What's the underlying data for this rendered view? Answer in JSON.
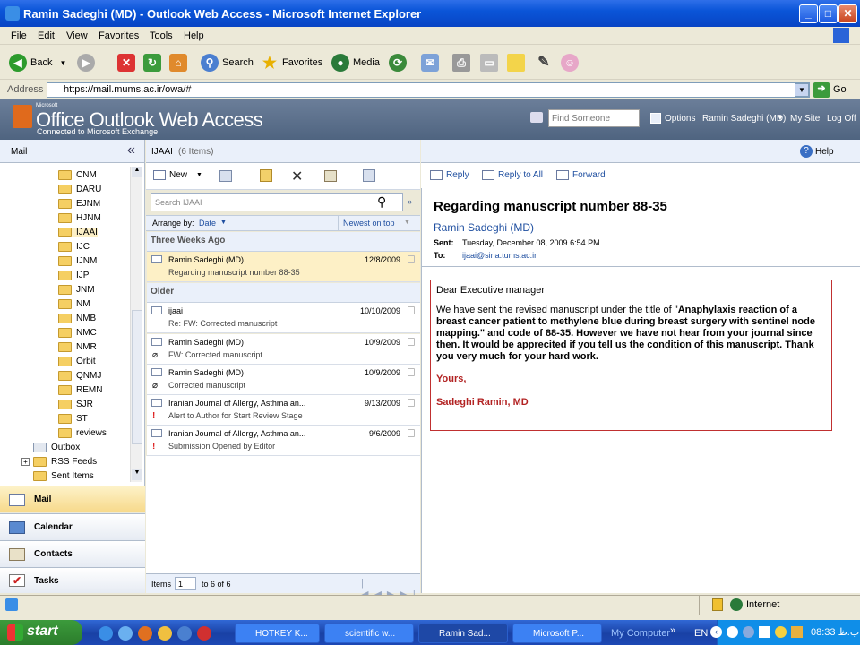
{
  "window": {
    "title": "Ramin Sadeghi (MD) - Outlook Web Access - Microsoft Internet Explorer"
  },
  "menu": [
    "File",
    "Edit",
    "View",
    "Favorites",
    "Tools",
    "Help"
  ],
  "toolbar": {
    "back": "Back",
    "search": "Search",
    "favorites": "Favorites",
    "media": "Media"
  },
  "address": {
    "label": "Address",
    "url": "https://mail.mums.ac.ir/owa/#",
    "go": "Go"
  },
  "owa": {
    "ms": "Microsoft",
    "brand": "Office Outlook Web Access",
    "subtitle": "Connected to Microsoft Exchange",
    "find_placeholder": "Find Someone",
    "options": "Options",
    "user": "Ramin Sadeghi (MD)",
    "my_site": "My Site",
    "log_off": "Log Off",
    "help": "Help"
  },
  "nav": {
    "header": "Mail",
    "folders": [
      "CNM",
      "DARU",
      "EJNM",
      "HJNM",
      "IJAAI",
      "IJC",
      "IJNM",
      "IJP",
      "JNM",
      "NM",
      "NMB",
      "NMC",
      "NMR",
      "Orbit",
      "QNMJ",
      "REMN",
      "SJR",
      "ST",
      "reviews"
    ],
    "outbox": "Outbox",
    "rss": "RSS Feeds",
    "sent": "Sent Items",
    "buttons": [
      "Mail",
      "Calendar",
      "Contacts",
      "Tasks"
    ]
  },
  "list": {
    "folder": "IJAAI",
    "count": "(6 Items)",
    "new_label": "New",
    "search_placeholder": "Search IJAAI",
    "arrange_by": "Arrange by:",
    "arrange_field": "Date",
    "sort": "Newest on top",
    "groups": [
      "Three Weeks Ago",
      "Older"
    ],
    "messages": [
      {
        "from": "Ramin Sadeghi (MD)",
        "subject": "Regarding manuscript number 88-35",
        "date": "12/8/2009"
      },
      {
        "from": "ijaai",
        "subject": "Re: FW: Corrected manuscript",
        "date": "10/10/2009"
      },
      {
        "from": "Ramin Sadeghi (MD)",
        "subject": "FW: Corrected manuscript",
        "date": "10/9/2009"
      },
      {
        "from": "Ramin Sadeghi (MD)",
        "subject": "Corrected manuscript",
        "date": "10/9/2009"
      },
      {
        "from": "Iranian Journal of Allergy, Asthma an...",
        "subject": "Alert to Author for Start Review Stage",
        "date": "9/13/2009"
      },
      {
        "from": "Iranian Journal of Allergy, Asthma an...",
        "subject": "Submission Opened by Editor",
        "date": "9/6/2009"
      }
    ],
    "footer_items": "Items",
    "footer_page": "1",
    "footer_range": "to 6 of 6"
  },
  "reading": {
    "reply": "Reply",
    "reply_all": "Reply to All",
    "forward": "Forward",
    "subject": "Regarding manuscript number 88-35",
    "sender": "Ramin Sadeghi (MD)",
    "sent_label": "Sent:",
    "sent_value": "Tuesday, December 08, 2009 6:54 PM",
    "to_label": "To:",
    "to_value": "ijaai@sina.tums.ac.ir",
    "greeting": "Dear Executive manager",
    "para_start": "We have sent the revised manuscript under the title of \"",
    "para_bold": "Anaphylaxis reaction of a breast cancer patient to methylene blue during breast surgery with sentinel node mapping.\" and code of 88-35. However we have not hear from your journal since then. It would be apprecited if you tell us the condition of this manuscript. Thank you very much for your hard work.",
    "closing": "Yours,",
    "signature": "Sadeghi Ramin, MD"
  },
  "status": {
    "zone": "Internet"
  },
  "taskbar": {
    "start": "start",
    "tasks": [
      "HOTKEY K...",
      "scientific w...",
      "Ramin Sad...",
      "Microsoft P..."
    ],
    "mycomputer": "My Computer",
    "lang": "EN",
    "clock": "08:33 ب.ظ"
  },
  "colors": {
    "titlebar": "#0a55d8",
    "owa_header": "#5b6f8c",
    "selected_row": "#fdf0c6",
    "body_border": "#c03030",
    "closing_red": "#b22222",
    "link_blue": "#1f4fa0"
  }
}
